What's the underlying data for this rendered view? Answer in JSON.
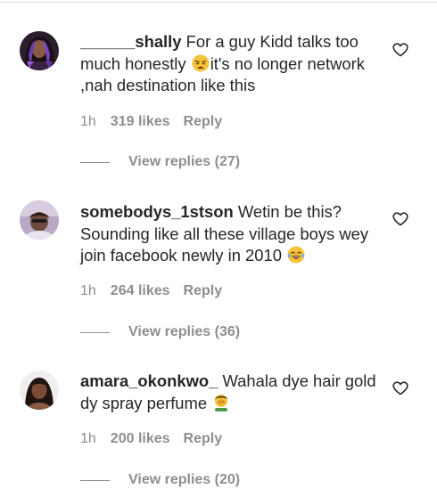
{
  "comments": [
    {
      "username": "______shally",
      "text_before": "For a guy Kidd talks too much honestly ",
      "emoji": "weary-face",
      "text_after": "it's no longer network ,nah destination like this",
      "time": "1h",
      "likes": "319 likes",
      "reply_label": "Reply",
      "view_replies": "View replies (27)"
    },
    {
      "username": "somebodys_1stson",
      "text_before": "Wetin be this? Sounding like all these village boys wey join facebook newly in 2010 ",
      "emoji": "tears-of-joy",
      "text_after": "",
      "time": "1h",
      "likes": "264 likes",
      "reply_label": "Reply",
      "view_replies": "View replies (36)"
    },
    {
      "username": "amara_okonkwo_",
      "text_before": "Wahala dye hair gold dy spray perfume ",
      "emoji": "facepalm",
      "text_after": "",
      "time": "1h",
      "likes": "200 likes",
      "reply_label": "Reply",
      "view_replies": "View replies (20)"
    }
  ],
  "colors": {
    "text": "#262626",
    "secondary": "#8e8e8e",
    "divider": "#dbdbdb"
  }
}
